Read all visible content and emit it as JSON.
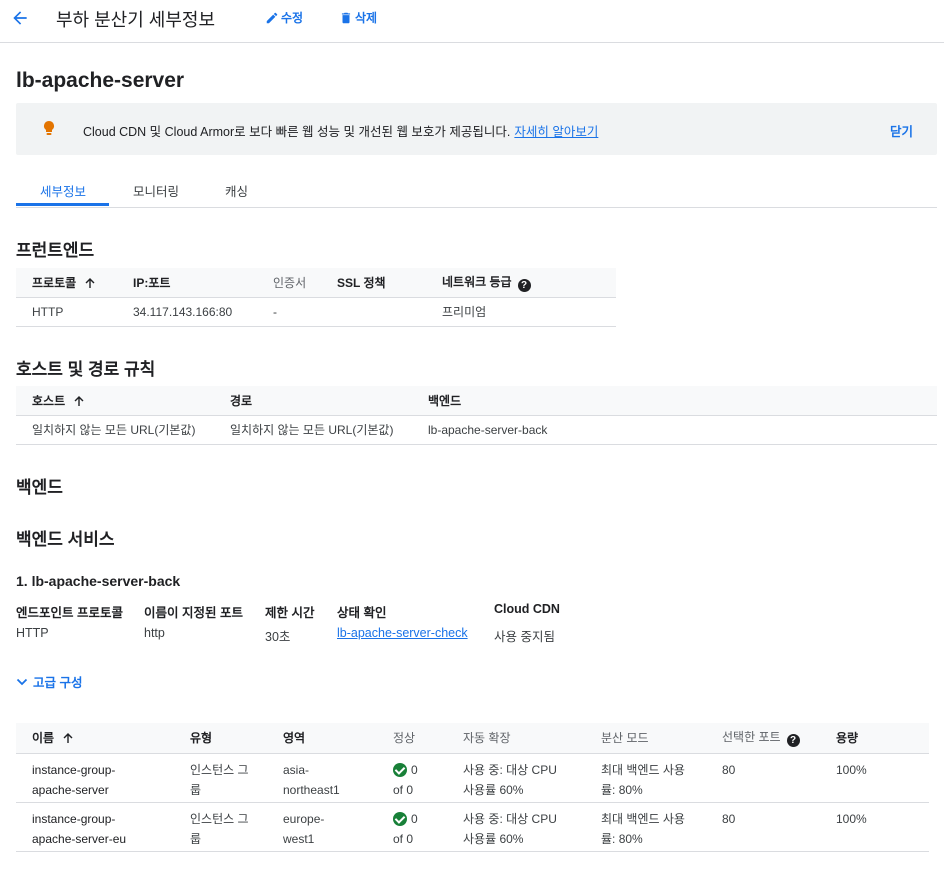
{
  "header": {
    "title": "부하 분산기 세부정보",
    "edit_label": "수정",
    "delete_label": "삭제"
  },
  "lb_name": "lb-apache-server",
  "banner": {
    "text": "Cloud CDN 및 Cloud Armor로 보다 빠른 웹 성능 및 개선된 웹 보호가 제공됩니다.",
    "link": "자세히 알아보기",
    "close": "닫기"
  },
  "tabs": [
    "세부정보",
    "모니터링",
    "캐싱"
  ],
  "frontend": {
    "heading": "프런트엔드",
    "columns": [
      "프로토콜",
      "IP:포트",
      "인증서",
      "SSL 정책",
      "네트워크 등급"
    ],
    "row": [
      "HTTP",
      "34.117.143.166:80",
      "-",
      "",
      "프리미엄"
    ]
  },
  "host_rules": {
    "heading": "호스트 및 경로 규칙",
    "columns": [
      "호스트",
      "경로",
      "백엔드"
    ],
    "row": [
      "일치하지 않는 모든 URL(기본값)",
      "일치하지 않는 모든 URL(기본값)",
      "lb-apache-server-back"
    ]
  },
  "backend": {
    "heading": "백엔드",
    "services_heading": "백엔드 서비스",
    "service_title": "1. lb-apache-server-back",
    "labels": [
      "엔드포인트 프로토콜",
      "이름이 지정된 포트",
      "제한 시간",
      "상태 확인",
      "Cloud CDN"
    ],
    "values": [
      "HTTP",
      "http",
      "30초",
      "lb-apache-server-check",
      "사용 중지됨"
    ],
    "advanced_label": "고급 구성",
    "table": {
      "columns": [
        "이름",
        "유형",
        "영역",
        "정상",
        "자동 확장",
        "분산 모드",
        "선택한 포트",
        "용량"
      ],
      "rows": [
        {
          "name": [
            "instance-group-",
            "apache-server"
          ],
          "type": [
            "인스턴스 그",
            "룹"
          ],
          "zone": [
            "asia-",
            "northeast1"
          ],
          "healthy": [
            "0",
            "of 0"
          ],
          "autoscale": [
            "사용 중: 대상 CPU",
            "사용률 60%"
          ],
          "mode": [
            "최대 백엔드 사용",
            "률: 80%"
          ],
          "port": "80",
          "capacity": "100%"
        },
        {
          "name": [
            "instance-group-",
            "apache-server-eu"
          ],
          "type": [
            "인스턴스 그",
            "룹"
          ],
          "zone": [
            "europe-",
            "west1"
          ],
          "healthy": [
            "0",
            "of 0"
          ],
          "autoscale": [
            "사용 중: 대상 CPU",
            "사용률 60%"
          ],
          "mode": [
            "최대 백엔드 사용",
            "률: 80%"
          ],
          "port": "80",
          "capacity": "100%"
        }
      ]
    }
  },
  "colors": {
    "accent": "#1a73e8",
    "ok": "#188038",
    "bulb": "#e37400"
  }
}
